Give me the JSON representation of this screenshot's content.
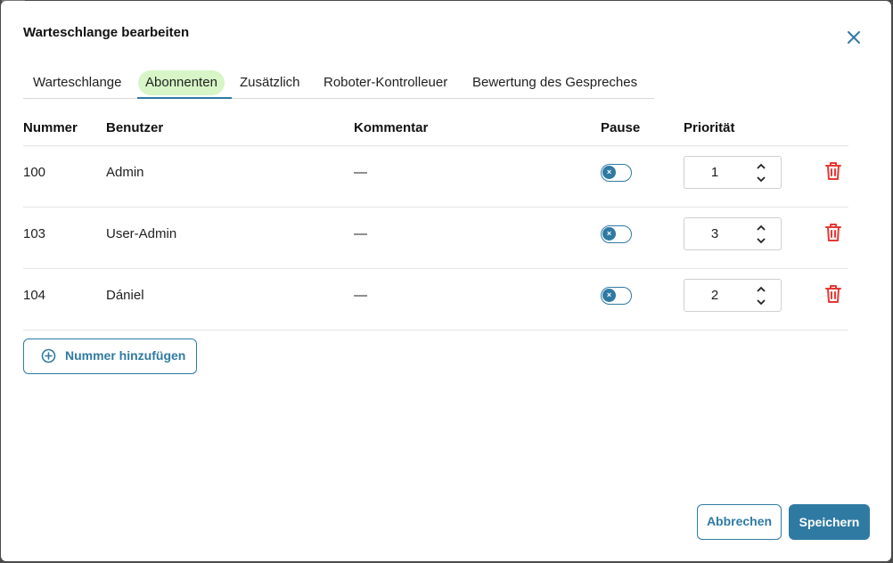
{
  "dialog": {
    "title": "Warteschlange bearbeiten",
    "close_icon": "close-icon"
  },
  "tabs": [
    {
      "label": "Warteschlange",
      "active": false
    },
    {
      "label": "Abonnenten",
      "active": true
    },
    {
      "label": "Zusätzlich",
      "active": false
    },
    {
      "label": "Roboter-Kontrolleuer",
      "active": false
    },
    {
      "label": "Bewertung des Gespreches",
      "active": false
    }
  ],
  "table": {
    "headers": {
      "number": "Nummer",
      "user": "Benutzer",
      "comment": "Kommentar",
      "pause": "Pause",
      "priority": "Priorität"
    },
    "rows": [
      {
        "number": "100",
        "user": "Admin",
        "comment": "—",
        "pause": false,
        "pause_icon": "×",
        "priority": "1"
      },
      {
        "number": "103",
        "user": "User-Admin",
        "comment": "—",
        "pause": false,
        "pause_icon": "×",
        "priority": "3"
      },
      {
        "number": "104",
        "user": "Dániel",
        "comment": "—",
        "pause": false,
        "pause_icon": "×",
        "priority": "2"
      }
    ]
  },
  "add_button": {
    "label": "Nummer hinzufügen",
    "icon": "add-circle-icon"
  },
  "footer": {
    "cancel_label": "Abbrechen",
    "save_label": "Speichern"
  },
  "colors": {
    "accent": "#2f7aa3",
    "active_tab_bg": "#d7f5c7",
    "delete": "#e53935"
  }
}
